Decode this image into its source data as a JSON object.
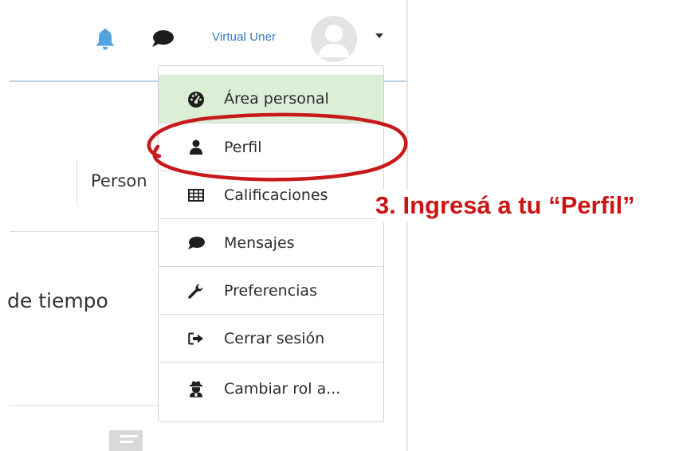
{
  "header": {
    "username": "Virtual Uner",
    "icons": {
      "notifications": "bell-icon",
      "messages": "chat-bubble-icon",
      "user_menu_toggle": "caret-down-icon"
    }
  },
  "background": {
    "tab_partial_label": "Person",
    "section_partial_text": "de tiempo"
  },
  "user_menu": {
    "items": [
      {
        "label": "Área personal",
        "icon": "dashboard-gauge-icon",
        "active": true
      },
      {
        "label": "Perfil",
        "icon": "user-icon"
      },
      {
        "label": "Calificaciones",
        "icon": "table-grid-icon"
      },
      {
        "label": "Mensajes",
        "icon": "chat-bubble-icon"
      },
      {
        "label": "Preferencias",
        "icon": "wrench-icon"
      },
      {
        "label": "Cerrar sesión",
        "icon": "sign-out-icon"
      },
      {
        "label": "Cambiar rol a...",
        "icon": "user-secret-icon"
      }
    ]
  },
  "annotation": {
    "text": "3. Ingresá a tu “Perfil”",
    "color": "#cc1414"
  },
  "colors": {
    "accent_link": "#2f7bc4",
    "active_item_bg": "#dcefd6",
    "nav_border": "#b6d0ea"
  }
}
